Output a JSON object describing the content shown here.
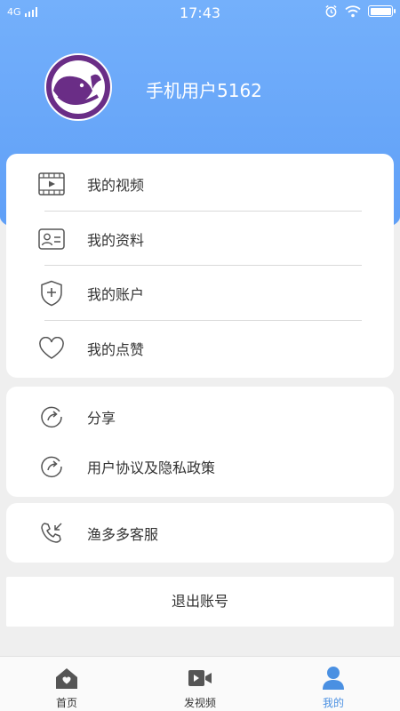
{
  "status_bar": {
    "network": "4G",
    "time": "17:43",
    "battery_level": 1.0
  },
  "profile": {
    "username": "手机用户5162"
  },
  "menu_group_1": [
    {
      "label": "我的视频",
      "icon": "video-icon"
    },
    {
      "label": "我的资料",
      "icon": "profile-card-icon"
    },
    {
      "label": "我的账户",
      "icon": "shield-plus-icon"
    },
    {
      "label": "我的点赞",
      "icon": "heart-icon"
    }
  ],
  "menu_group_2": [
    {
      "label": "分享",
      "icon": "share-icon"
    },
    {
      "label": "用户协议及隐私政策",
      "icon": "share-icon"
    }
  ],
  "menu_group_3": [
    {
      "label": "渔多多客服",
      "icon": "phone-incoming-icon"
    }
  ],
  "logout": {
    "label": "退出账号"
  },
  "tabbar": [
    {
      "label": "首页",
      "icon": "home-icon",
      "active": false
    },
    {
      "label": "发视频",
      "icon": "camera-icon",
      "active": false
    },
    {
      "label": "我的",
      "icon": "user-icon",
      "active": true
    }
  ],
  "colors": {
    "header": "#6aa8f9",
    "accent": "#4a90e2",
    "avatar_bg": "#6a2d86"
  }
}
